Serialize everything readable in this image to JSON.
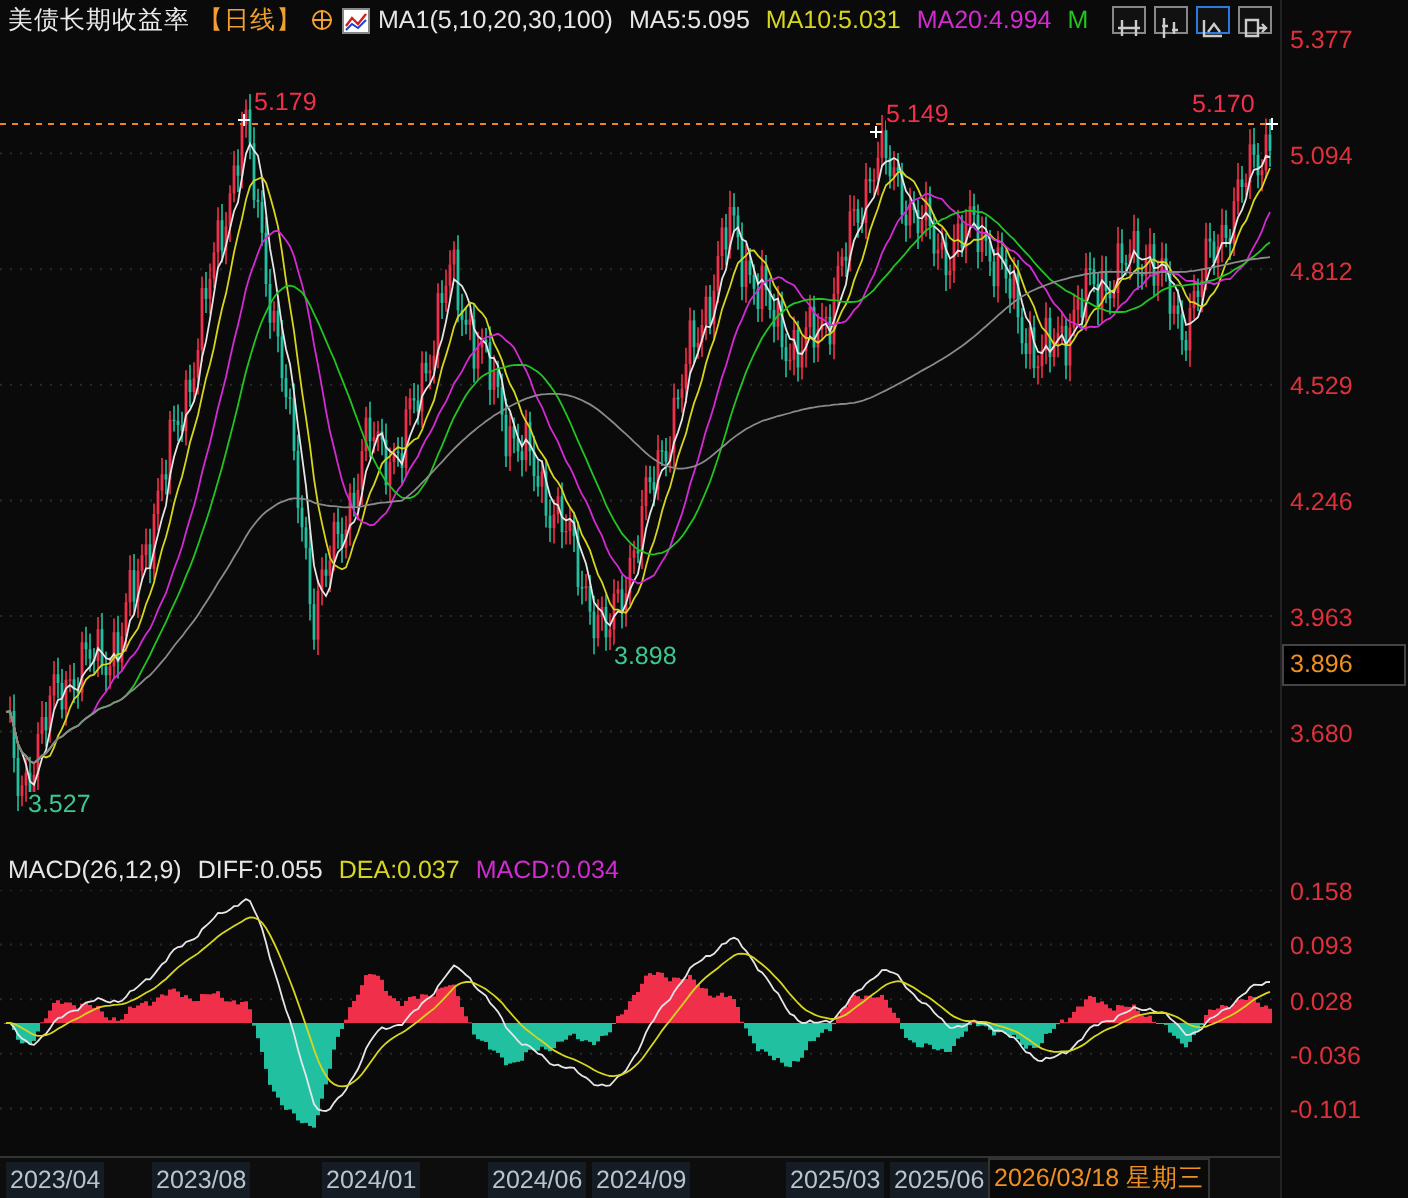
{
  "header": {
    "title": "美债长期收益率",
    "period": "【日线】",
    "ma_label": "MA1(5,10,20,30,100)",
    "ma_values": [
      {
        "text": "MA5:5.095",
        "color": "#e6e6e6"
      },
      {
        "text": "MA10:5.031",
        "color": "#d6d61e"
      },
      {
        "text": "MA20:4.994",
        "color": "#d42ad4"
      },
      {
        "text": "M",
        "color": "#22c422"
      }
    ]
  },
  "toolbar_buttons": [
    {
      "selected": false
    },
    {
      "selected": false
    },
    {
      "selected": true
    },
    {
      "selected": false
    }
  ],
  "price_axis": [
    "5.377",
    "5.094",
    "4.812",
    "4.529",
    "4.246",
    "3.963",
    "3.680"
  ],
  "current_price": "3.896",
  "annotations": [
    {
      "text": "5.179",
      "kind": "high"
    },
    {
      "text": "5.149",
      "kind": "high"
    },
    {
      "text": "5.170",
      "kind": "high"
    },
    {
      "text": "3.898",
      "kind": "low"
    },
    {
      "text": "3.527",
      "kind": "low"
    }
  ],
  "macd": {
    "label": "MACD(26,12,9)",
    "values": [
      {
        "text": "DIFF:0.055",
        "color": "#e6e6e6"
      },
      {
        "text": "DEA:0.037",
        "color": "#d6d61e"
      },
      {
        "text": "MACD:0.034",
        "color": "#d42ad4"
      }
    ]
  },
  "macd_axis": [
    "0.158",
    "0.093",
    "0.028",
    "-0.036",
    "-0.101"
  ],
  "date_axis": [
    {
      "text": "2023/04",
      "selected": false
    },
    {
      "text": "2023/08",
      "selected": false
    },
    {
      "text": "2024/01",
      "selected": false
    },
    {
      "text": "2024/06",
      "selected": false
    },
    {
      "text": "2024/09",
      "selected": false
    },
    {
      "text": "2025/03",
      "selected": false
    },
    {
      "text": "2025/06",
      "selected": false
    },
    {
      "text": "2026/03/18 星期三",
      "selected": true
    }
  ]
}
